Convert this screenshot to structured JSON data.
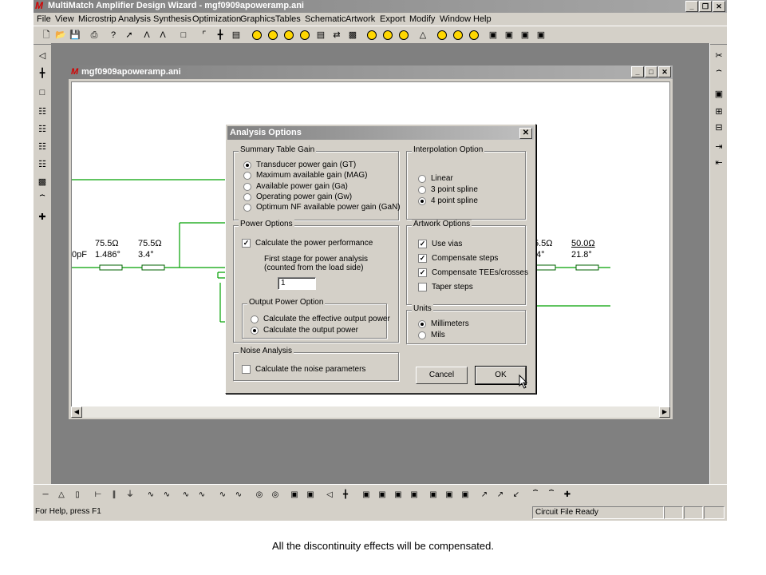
{
  "app": {
    "title": "MultiMatch Amplifier Design Wizard - mgf0909apoweramp.ani",
    "logo": "M",
    "min": "_",
    "restore": "❐",
    "close": "✕"
  },
  "menu": [
    "File",
    "View",
    "Microstrip",
    "Analysis",
    "Synthesis",
    "Optimization",
    "Graphics",
    "Tables",
    "Schematic",
    "Artwork",
    "Export",
    "Modify",
    "Window",
    "Help"
  ],
  "child": {
    "title": "mgf0909apoweramp.ani",
    "logo": "M",
    "min": "_",
    "restore": "□",
    "close": "✕"
  },
  "circuit": {
    "left_cap": "0pF",
    "seg1_z": "75.5Ω",
    "seg1_a": "1.486°",
    "seg2_z": "75.5Ω",
    "seg2_a": "3.4°",
    "seg3_z": "5.5Ω",
    "seg3_a": "4°",
    "seg4_z": "50.0Ω",
    "seg4_a": "21.8°"
  },
  "dialog": {
    "title": "Analysis Options",
    "close": "✕",
    "summary": {
      "label": "Summary Table Gain",
      "options": [
        {
          "label": "Transducer power gain (GT)",
          "selected": true
        },
        {
          "label": "Maximum available gain (MAG)",
          "selected": false
        },
        {
          "label": "Available power gain (Ga)",
          "selected": false
        },
        {
          "label": "Operating power gain (Gw)",
          "selected": false
        },
        {
          "label": "Optimum NF available power gain (GaN)",
          "selected": false
        }
      ]
    },
    "interpolation": {
      "label": "Interpolation Option",
      "options": [
        {
          "label": "Linear",
          "selected": false
        },
        {
          "label": "3 point spline",
          "selected": false
        },
        {
          "label": "4 point spline",
          "selected": true
        }
      ]
    },
    "power": {
      "label": "Power Options",
      "calc_label": "Calculate the power performance",
      "calc_checked": true,
      "first_stage_line1": "First stage for power analysis",
      "first_stage_line2": "(counted from the load side)",
      "first_stage_value": "1",
      "output": {
        "label": "Output Power Option",
        "options": [
          {
            "label": "Calculate the effective output power",
            "selected": false
          },
          {
            "label": "Calculate the output power",
            "selected": true
          }
        ]
      }
    },
    "artwork": {
      "label": "Artwork Options",
      "options": [
        {
          "label": "Use vias",
          "checked": true
        },
        {
          "label": "Compensate steps",
          "checked": true
        },
        {
          "label": "Compensate TEEs/crosses",
          "checked": true
        },
        {
          "label": "Taper steps",
          "checked": false
        }
      ]
    },
    "units": {
      "label": "Units",
      "options": [
        {
          "label": "Millimeters",
          "selected": true
        },
        {
          "label": "Mils",
          "selected": false
        }
      ]
    },
    "noise": {
      "label": "Noise Analysis",
      "calc_label": "Calculate the noise parameters",
      "checked": false
    },
    "cancel_label": "Cancel",
    "ok_label": "OK"
  },
  "status": {
    "help": "For Help, press F1",
    "file": "Circuit File Ready"
  },
  "caption": "All the discontinuity effects will be compensated.",
  "colors": {
    "wire": "#00a000",
    "component": "#007000"
  }
}
